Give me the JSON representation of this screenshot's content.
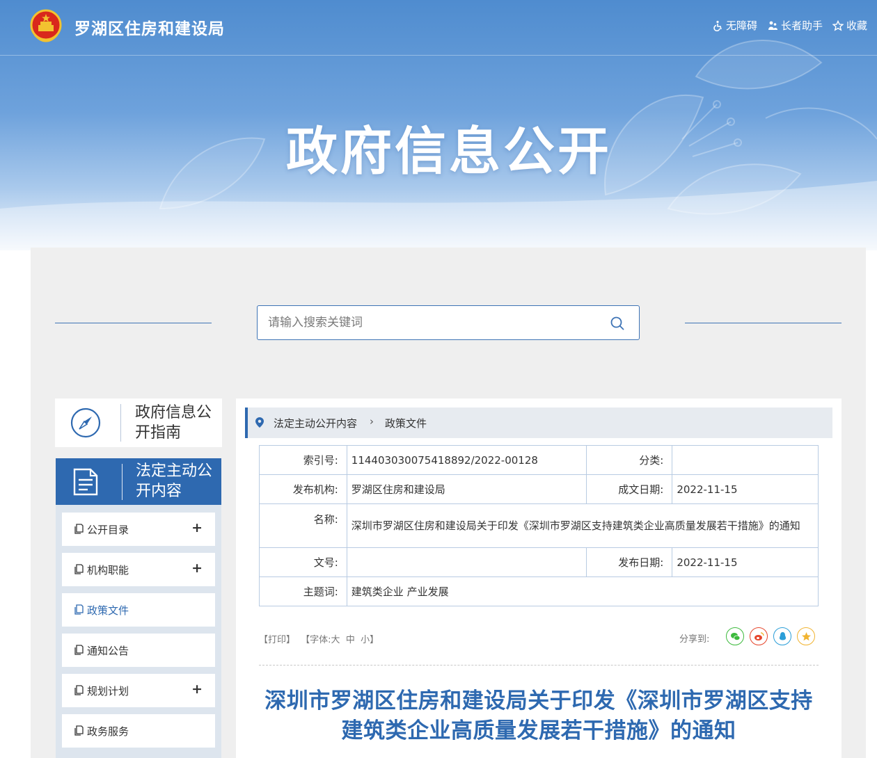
{
  "header": {
    "site_name": "罗湖区住房和建设局",
    "links": [
      {
        "icon": "wheelchair-icon",
        "label": "无障碍"
      },
      {
        "icon": "elder-icon",
        "label": "长者助手"
      },
      {
        "icon": "star-icon",
        "label": "收藏"
      }
    ]
  },
  "banner": {
    "title": "政府信息公开"
  },
  "search": {
    "placeholder": "请输入搜索关键词",
    "value": ""
  },
  "sidebar": {
    "guide": {
      "icon": "compass-icon",
      "label": "政府信息公开指南"
    },
    "legal": {
      "icon": "document-icon",
      "label": "法定主动公开内容"
    },
    "items": [
      {
        "label": "公开目录",
        "expandable": true,
        "active": false
      },
      {
        "label": "机构职能",
        "expandable": true,
        "active": false
      },
      {
        "label": "政策文件",
        "expandable": false,
        "active": true
      },
      {
        "label": "通知公告",
        "expandable": false,
        "active": false
      },
      {
        "label": "规划计划",
        "expandable": true,
        "active": false
      },
      {
        "label": "政务服务",
        "expandable": false,
        "active": false
      }
    ],
    "expand_symbol": "+"
  },
  "breadcrumb": {
    "items": [
      "法定主动公开内容",
      "政策文件"
    ],
    "separator": "›"
  },
  "meta": {
    "index_label": "索引号:",
    "index_value": "114403030075418892/2022-00128",
    "category_label": "分类:",
    "category_value": "",
    "publisher_label": "发布机构:",
    "publisher_value": "罗湖区住房和建设局",
    "written_label": "成文日期:",
    "written_value": "2022-11-15",
    "name_label": "名称:",
    "name_value": "深圳市罗湖区住房和建设局关于印发《深圳市罗湖区支持建筑类企业高质量发展若干措施》的通知",
    "docno_label": "文号:",
    "docno_value": "",
    "published_label": "发布日期:",
    "published_value": "2022-11-15",
    "keywords_label": "主题词:",
    "keywords_value": "建筑类企业 产业发展"
  },
  "tools": {
    "print": "【打印】",
    "font_prefix": "【字体:",
    "font_large": "大",
    "font_medium": "中",
    "font_small": "小",
    "font_suffix": "】",
    "share_label": "分享到:",
    "share_icons": [
      "wechat-icon",
      "weibo-icon",
      "qq-icon",
      "qzone-icon"
    ]
  },
  "article": {
    "title_line1": "深圳市罗湖区住房和建设局关于印发《深圳市罗湖区支持",
    "title_line2": "建筑类企业高质量发展若干措施》的通知"
  },
  "colors": {
    "brand": "#2e69b0",
    "grey_bg": "#efefef",
    "wechat": "#3dba3d",
    "weibo": "#e6462c",
    "qq": "#2b9ed8",
    "qzone": "#f1b431"
  }
}
